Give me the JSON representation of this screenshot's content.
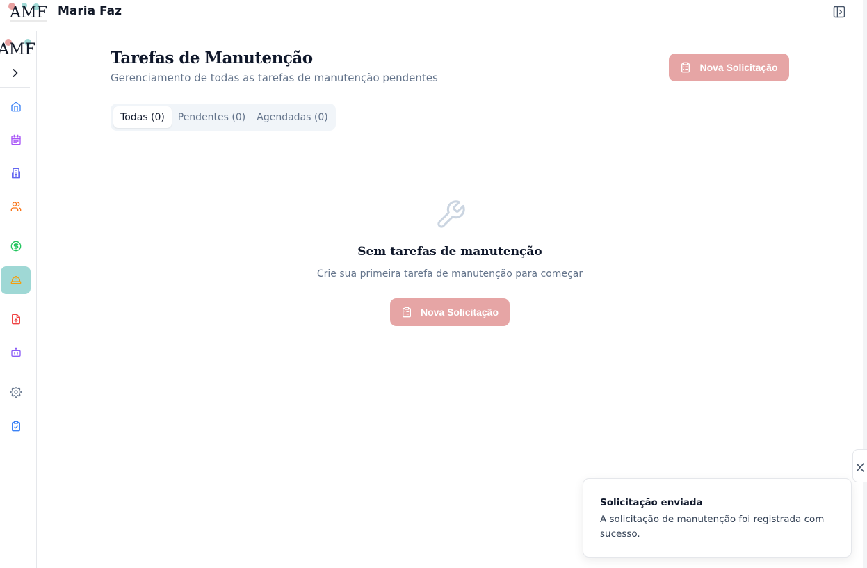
{
  "header": {
    "logo_text": "AMF",
    "brand_name": "Maria Faz",
    "panel_toggle_icon": "panel-right-icon"
  },
  "sidebar": {
    "logo_text": "AMF",
    "collapse_icon": "chevron-right-icon",
    "items": [
      {
        "icon": "home-icon",
        "color": "#3b82f6",
        "active": false
      },
      {
        "icon": "calendar-icon",
        "color": "#a855f7",
        "active": false
      },
      {
        "icon": "building-icon",
        "color": "#6366f1",
        "active": false
      },
      {
        "icon": "users-icon",
        "color": "#f97316",
        "active": false
      },
      {
        "icon": "dollar-circle-icon",
        "color": "#22c55e",
        "active": false
      },
      {
        "icon": "hard-hat-icon",
        "color": "#f59e0b",
        "active": true
      },
      {
        "icon": "file-upload-icon",
        "color": "#ef4444",
        "active": false
      },
      {
        "icon": "bot-icon",
        "color": "#8b5cf6",
        "active": false
      },
      {
        "icon": "gear-icon",
        "color": "#64748b",
        "active": false
      },
      {
        "icon": "clipboard-check-icon",
        "color": "#3b82f6",
        "active": false
      }
    ],
    "active_color": "#9fd8d5"
  },
  "main": {
    "title": "Tarefas de Manutenção",
    "subtitle": "Gerenciamento de todas as tarefas de manutenção pendentes",
    "new_request_label": "Nova Solicitação",
    "tabs": [
      {
        "label": "Todas (0)",
        "active": true
      },
      {
        "label": "Pendentes (0)",
        "active": false
      },
      {
        "label": "Agendadas (0)",
        "active": false
      }
    ],
    "empty_state": {
      "icon": "wrench-icon",
      "title": "Sem tarefas de manutenção",
      "description": "Crie sua primeira tarefa de manutenção para começar",
      "button_label": "Nova Solicitação"
    },
    "accent_color": "#e6a5a5"
  },
  "toast": {
    "title": "Solicitação enviada",
    "body": "A solicitação de manutenção foi registrada com sucesso."
  }
}
